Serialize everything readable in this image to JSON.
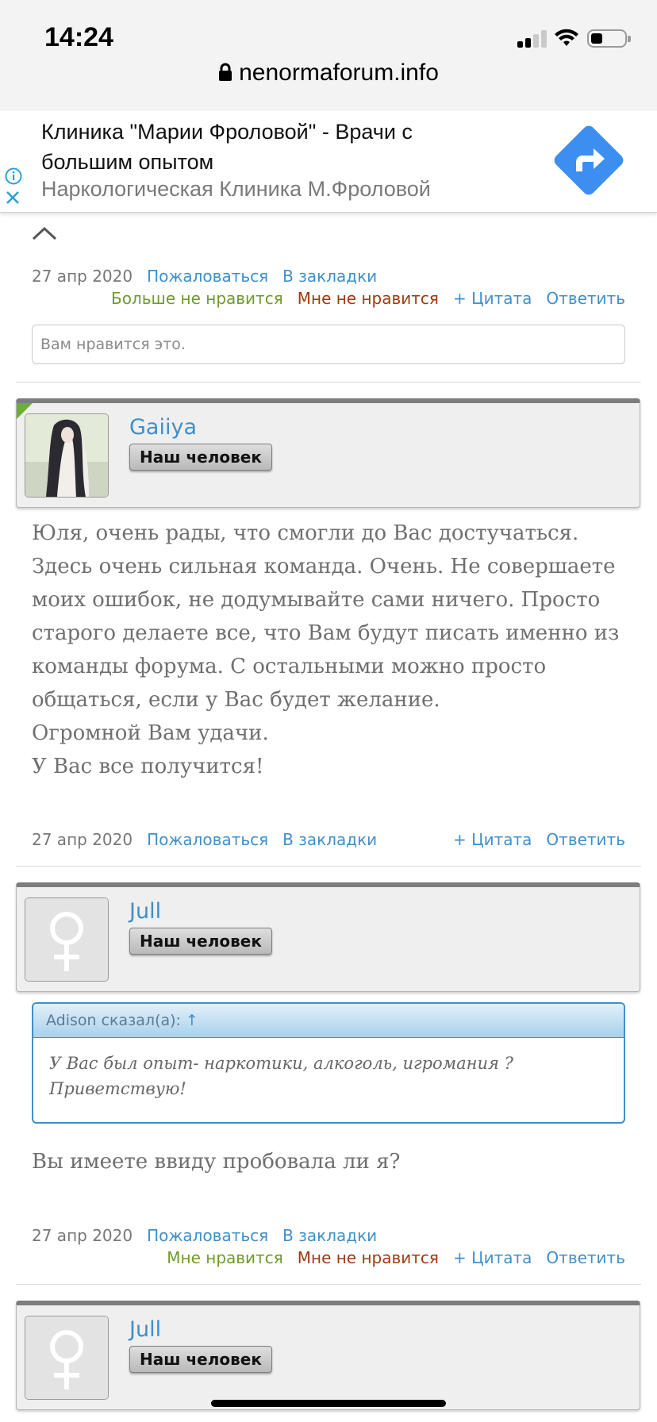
{
  "status": {
    "time": "14:24"
  },
  "browser": {
    "url": "nenormaforum.info"
  },
  "ad": {
    "title": "Клиника \"Марии Фроловой\" - Врачи с большим опытом",
    "subtitle": "Наркологическая Клиника М.Фроловой"
  },
  "labels": {
    "report": "Пожаловаться",
    "bookmark": "В закладки",
    "quote": "+ Цитата",
    "reply": "Ответить",
    "like": "Мне нравится",
    "unlike": "Больше не нравится",
    "dislike": "Мне не нравится"
  },
  "post0": {
    "date": "27 апр 2020",
    "like_box": "Вам нравится это."
  },
  "post1": {
    "author": "Gaiiya",
    "rank": "Наш человек",
    "lines": [
      "Юля, очень рады, что смогли до Вас достучаться.",
      "Здесь очень сильная команда. Очень. Не совершаете",
      "моих ошибок, не додумывайте сами ничего. Просто",
      "старого делаете все, что Вам будут писать именно из",
      "команды форума. С остальными можно просто",
      "общаться, если у Вас будет желание.",
      "Огромной Вам удачи.",
      "У Вас все получится!"
    ],
    "date": "27 апр 2020"
  },
  "post2": {
    "author": "Jull",
    "rank": "Наш человек",
    "quote_header": "Adison сказал(а):",
    "quote_arrow": "↑",
    "quote_lines": [
      "У Вас был опыт- наркотики, алкоголь, игромания ?",
      "Приветствую!"
    ],
    "text": "Вы имеете ввиду пробовала ли я?",
    "date": "27 апр 2020"
  },
  "post3": {
    "author": "Jull",
    "rank": "Наш человек"
  }
}
